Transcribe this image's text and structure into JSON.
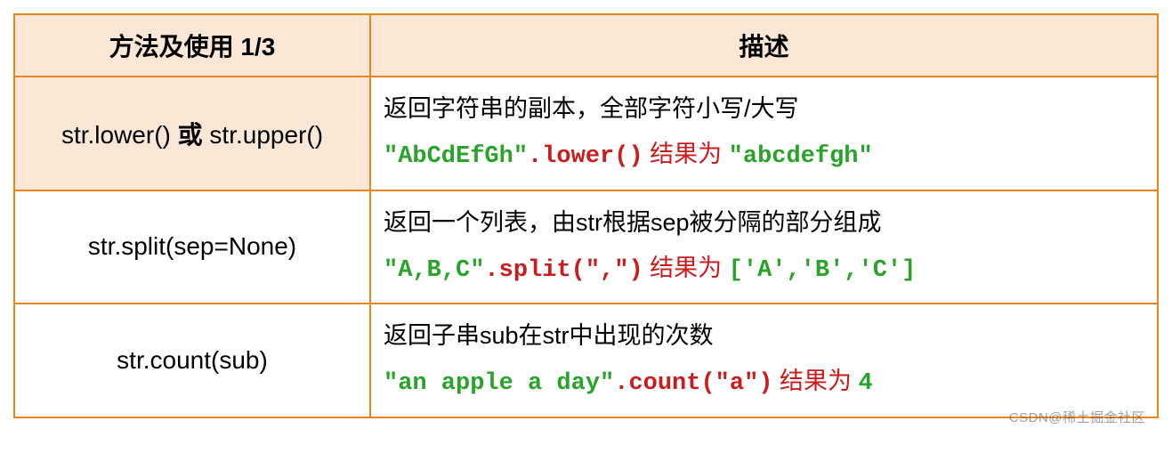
{
  "header": {
    "col1": "方法及使用 1/3",
    "col2": "描述"
  },
  "rows": [
    {
      "method_pre": "str.lower() ",
      "method_bold": "或",
      "method_post": " str.upper()",
      "desc_line1": "返回字符串的副本，全部字符小写/大写",
      "code_green": "\"AbCdEfGh\"",
      "code_red": ".lower()",
      "result_label": " 结果为 ",
      "result_green": "\"abcdefgh\""
    },
    {
      "method_pre": "str.split(sep=None)",
      "method_bold": "",
      "method_post": "",
      "desc_line1": "返回一个列表，由str根据sep被分隔的部分组成",
      "code_green": "\"A,B,C\"",
      "code_red": ".split(\",\")",
      "result_label": " 结果为 ",
      "result_green": "['A','B','C']"
    },
    {
      "method_pre": "str.count(sub)",
      "method_bold": "",
      "method_post": "",
      "desc_line1": "返回子串sub在str中出现的次数",
      "code_green": "\"an apple a day\"",
      "code_red": ".count(\"a\")",
      "result_label": " 结果为 ",
      "result_green": "4"
    }
  ],
  "watermark": "CSDN@稀土掘金社区"
}
